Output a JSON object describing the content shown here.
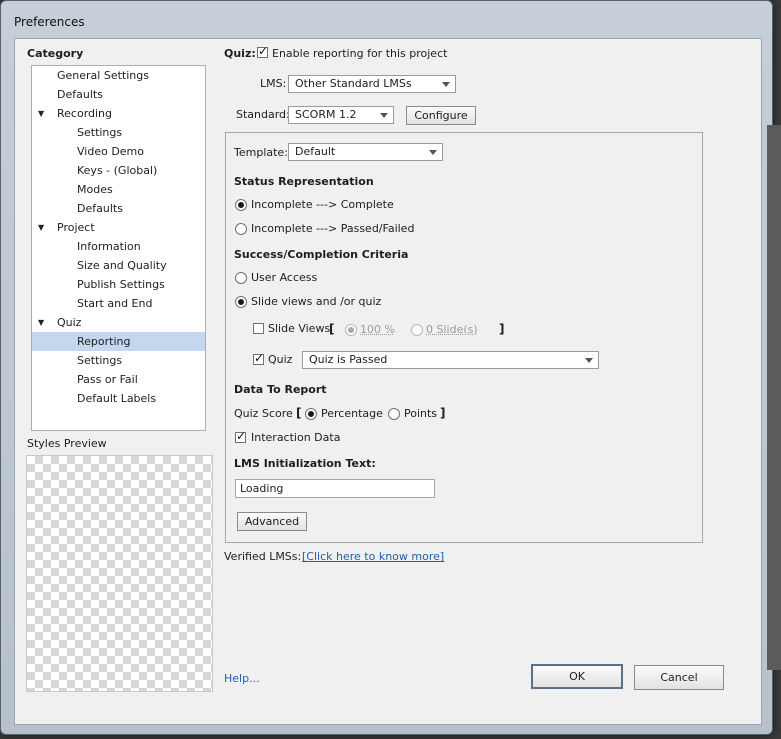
{
  "window": {
    "title": "Preferences"
  },
  "category": {
    "heading": "Category",
    "items": [
      {
        "label": "General Settings"
      },
      {
        "label": "Defaults"
      },
      {
        "label": "Recording"
      },
      {
        "label": "Settings"
      },
      {
        "label": "Video Demo"
      },
      {
        "label": "Keys - (Global)"
      },
      {
        "label": "Modes"
      },
      {
        "label": "Defaults"
      },
      {
        "label": "Project"
      },
      {
        "label": "Information"
      },
      {
        "label": "Size and Quality"
      },
      {
        "label": "Publish Settings"
      },
      {
        "label": "Start and End"
      },
      {
        "label": "Quiz"
      },
      {
        "label": "Reporting"
      },
      {
        "label": "Settings"
      },
      {
        "label": "Pass or Fail"
      },
      {
        "label": "Default Labels"
      }
    ],
    "selected": "Reporting"
  },
  "styles_preview": {
    "label": "Styles Preview"
  },
  "quiz": {
    "label": "Quiz:",
    "enable_reporting": {
      "label": "Enable reporting for this project",
      "checked": true
    }
  },
  "lms": {
    "label": "LMS:",
    "value": "Other Standard LMSs"
  },
  "standard": {
    "label": "Standard:",
    "value": "SCORM 1.2",
    "configure_label": "Configure"
  },
  "template": {
    "label": "Template:",
    "value": "Default"
  },
  "status_representation": {
    "heading": "Status Representation",
    "options": [
      "Incomplete ---> Complete",
      "Incomplete ---> Passed/Failed"
    ],
    "selected": "Incomplete ---> Complete"
  },
  "criteria": {
    "heading": "Success/Completion Criteria",
    "user_access": "User Access",
    "slide_views_or_quiz": "Slide views and /or quiz",
    "selected": "Slide views and /or quiz",
    "slide_views": {
      "label": "Slide Views",
      "checked": false,
      "bracket_open": "[",
      "bracket_close": "]",
      "percent": "100 %",
      "slides": "0 Slide(s)"
    },
    "quiz": {
      "label": "Quiz",
      "checked": true,
      "value": "Quiz is Passed"
    }
  },
  "data_to_report": {
    "heading": "Data To Report",
    "quiz_score_label": "Quiz Score",
    "bracket_open": "[",
    "bracket_close": "]",
    "percentage": "Percentage",
    "points": "Points",
    "selected": "Percentage",
    "interaction_data": {
      "label": "Interaction Data",
      "checked": true
    }
  },
  "lms_init": {
    "heading": "LMS Initialization Text:",
    "value": "Loading"
  },
  "advanced_label": "Advanced",
  "verified": {
    "label": "Verified LMSs:",
    "link": "[Click here to know more]"
  },
  "help_label": "Help...",
  "ok_label": "OK",
  "cancel_label": "Cancel",
  "colors": {
    "selection": "#c4d7ee",
    "link": "#1f5fae",
    "title_gradient": "#c6ced8"
  }
}
